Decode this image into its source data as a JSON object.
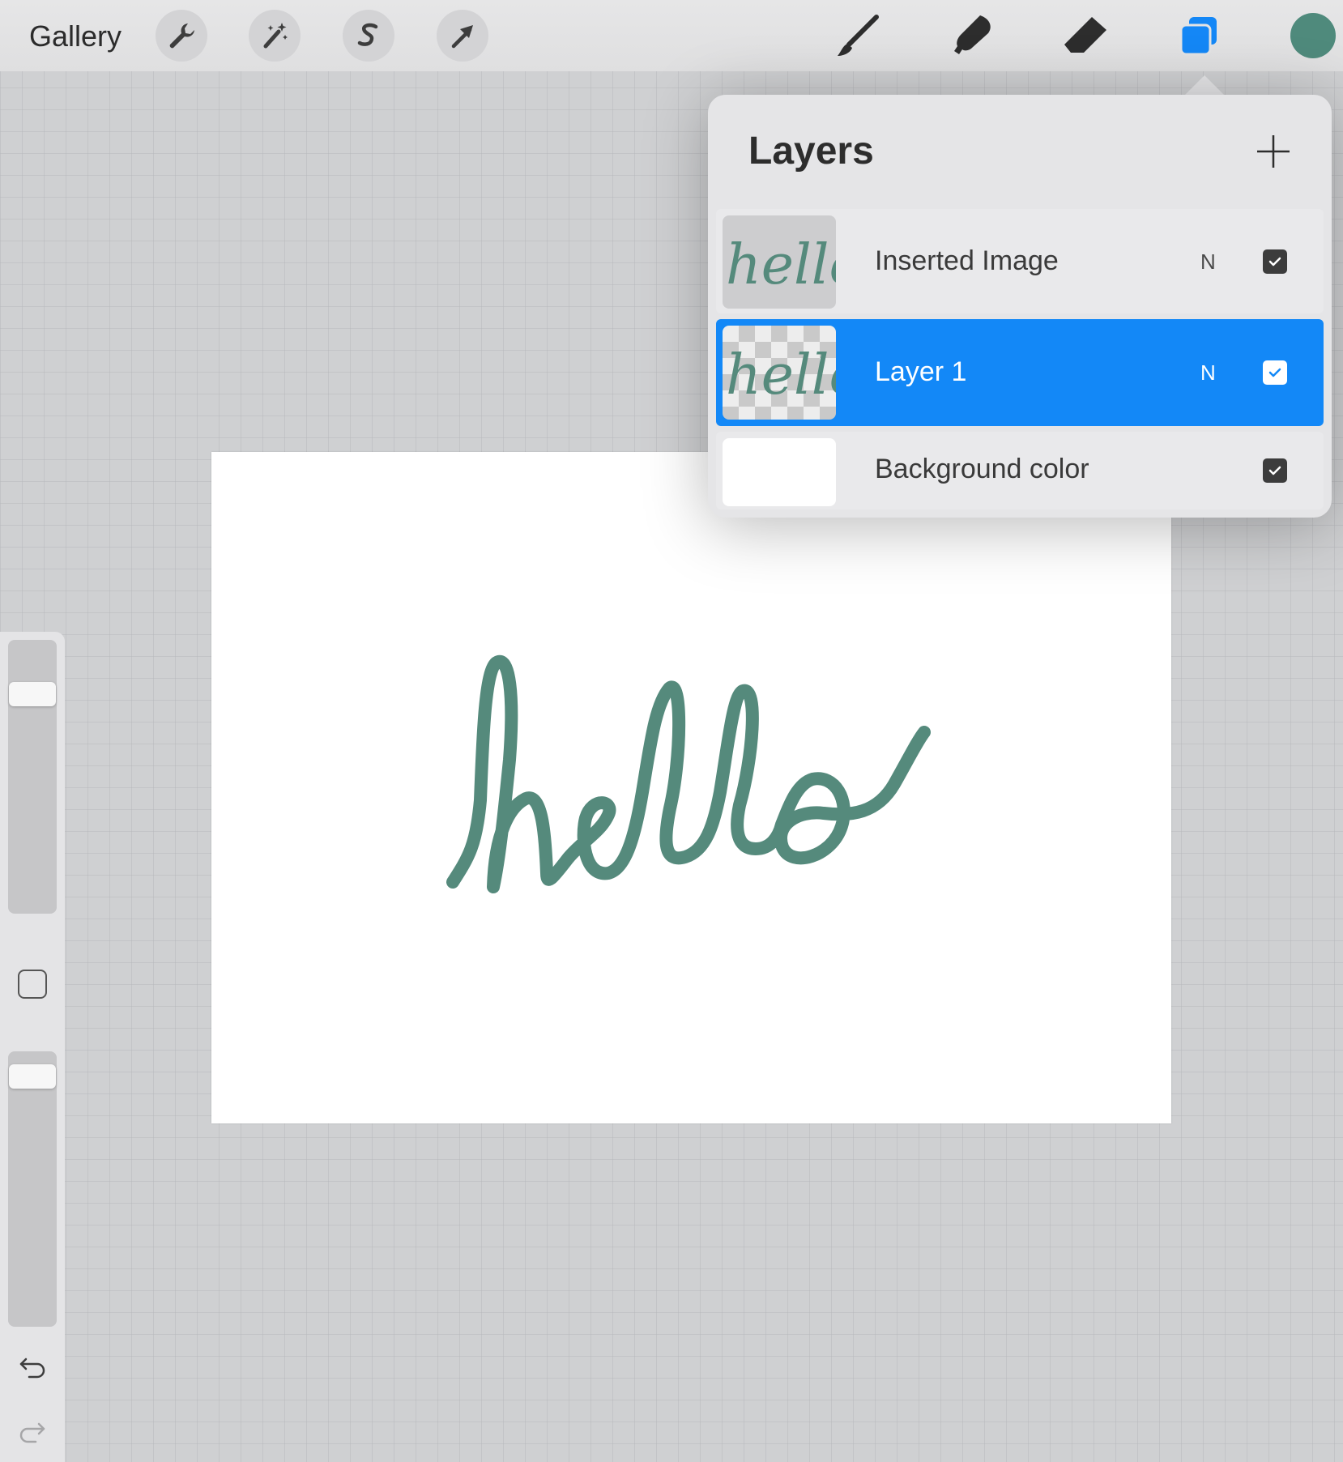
{
  "toolbar": {
    "gallery_label": "Gallery",
    "left_tools": [
      "wrench-icon",
      "magic-wand-icon",
      "selection-s-icon",
      "arrow-cursor-icon"
    ],
    "right_tools": [
      "brush-icon",
      "smudge-icon",
      "eraser-icon",
      "layers-icon"
    ],
    "current_color": "#4f8a7c",
    "active_tool_color": "#1487f6"
  },
  "layers_panel": {
    "title": "Layers",
    "add_icon": "plus-icon",
    "layers": [
      {
        "name": "Inserted Image",
        "blend": "N",
        "visible": true,
        "selected": false,
        "thumbnail": "hello"
      },
      {
        "name": "Layer 1",
        "blend": "N",
        "visible": true,
        "selected": true,
        "thumbnail": "hello"
      },
      {
        "name": "Background color",
        "blend": "",
        "visible": true,
        "selected": false,
        "thumbnail": ""
      }
    ]
  },
  "canvas": {
    "artwork_text": "hello",
    "ink_color": "#558a7c"
  },
  "sidebar": {
    "brush_size_level": 0.83,
    "opacity_level": 0.95,
    "undo_icon": "undo-icon",
    "redo_icon": "redo-icon"
  }
}
